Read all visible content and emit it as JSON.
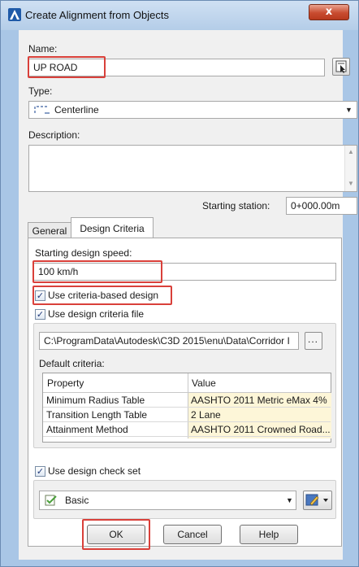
{
  "window": {
    "title": "Create Alignment from Objects",
    "close_glyph": "x"
  },
  "name": {
    "label": "Name:",
    "value": "UP ROAD"
  },
  "type": {
    "label": "Type:",
    "value": "Centerline"
  },
  "description": {
    "label": "Description:",
    "value": ""
  },
  "starting_station": {
    "label": "Starting station:",
    "value": "0+000.00m"
  },
  "tabs": [
    {
      "label": "General"
    },
    {
      "label": "Design Criteria"
    }
  ],
  "design": {
    "speed_label": "Starting design speed:",
    "speed_value": "100 km/h",
    "use_criteria_label": "Use criteria-based design",
    "use_criteria_checked": true,
    "use_file_label": "Use design criteria file",
    "use_file_checked": true,
    "file_path": "C:\\ProgramData\\Autodesk\\C3D 2015\\enu\\Data\\Corridor I",
    "browse_label": "...",
    "default_criteria_label": "Default criteria:",
    "columns": [
      "Property",
      "Value"
    ],
    "rows": [
      {
        "property": "Minimum Radius Table",
        "value": "AASHTO 2011 Metric eMax 4%"
      },
      {
        "property": "Transition Length Table",
        "value": "2 Lane"
      },
      {
        "property": "Attainment Method",
        "value": "AASHTO 2011 Crowned Road..."
      }
    ],
    "use_check_set_label": "Use design check set",
    "use_check_set_checked": true,
    "check_set_value": "Basic"
  },
  "buttons": {
    "ok": "OK",
    "cancel": "Cancel",
    "help": "Help"
  },
  "colors": {
    "highlight_box": "#d9403a",
    "titlebar": "#b4cde8",
    "close": "#c84c30"
  }
}
